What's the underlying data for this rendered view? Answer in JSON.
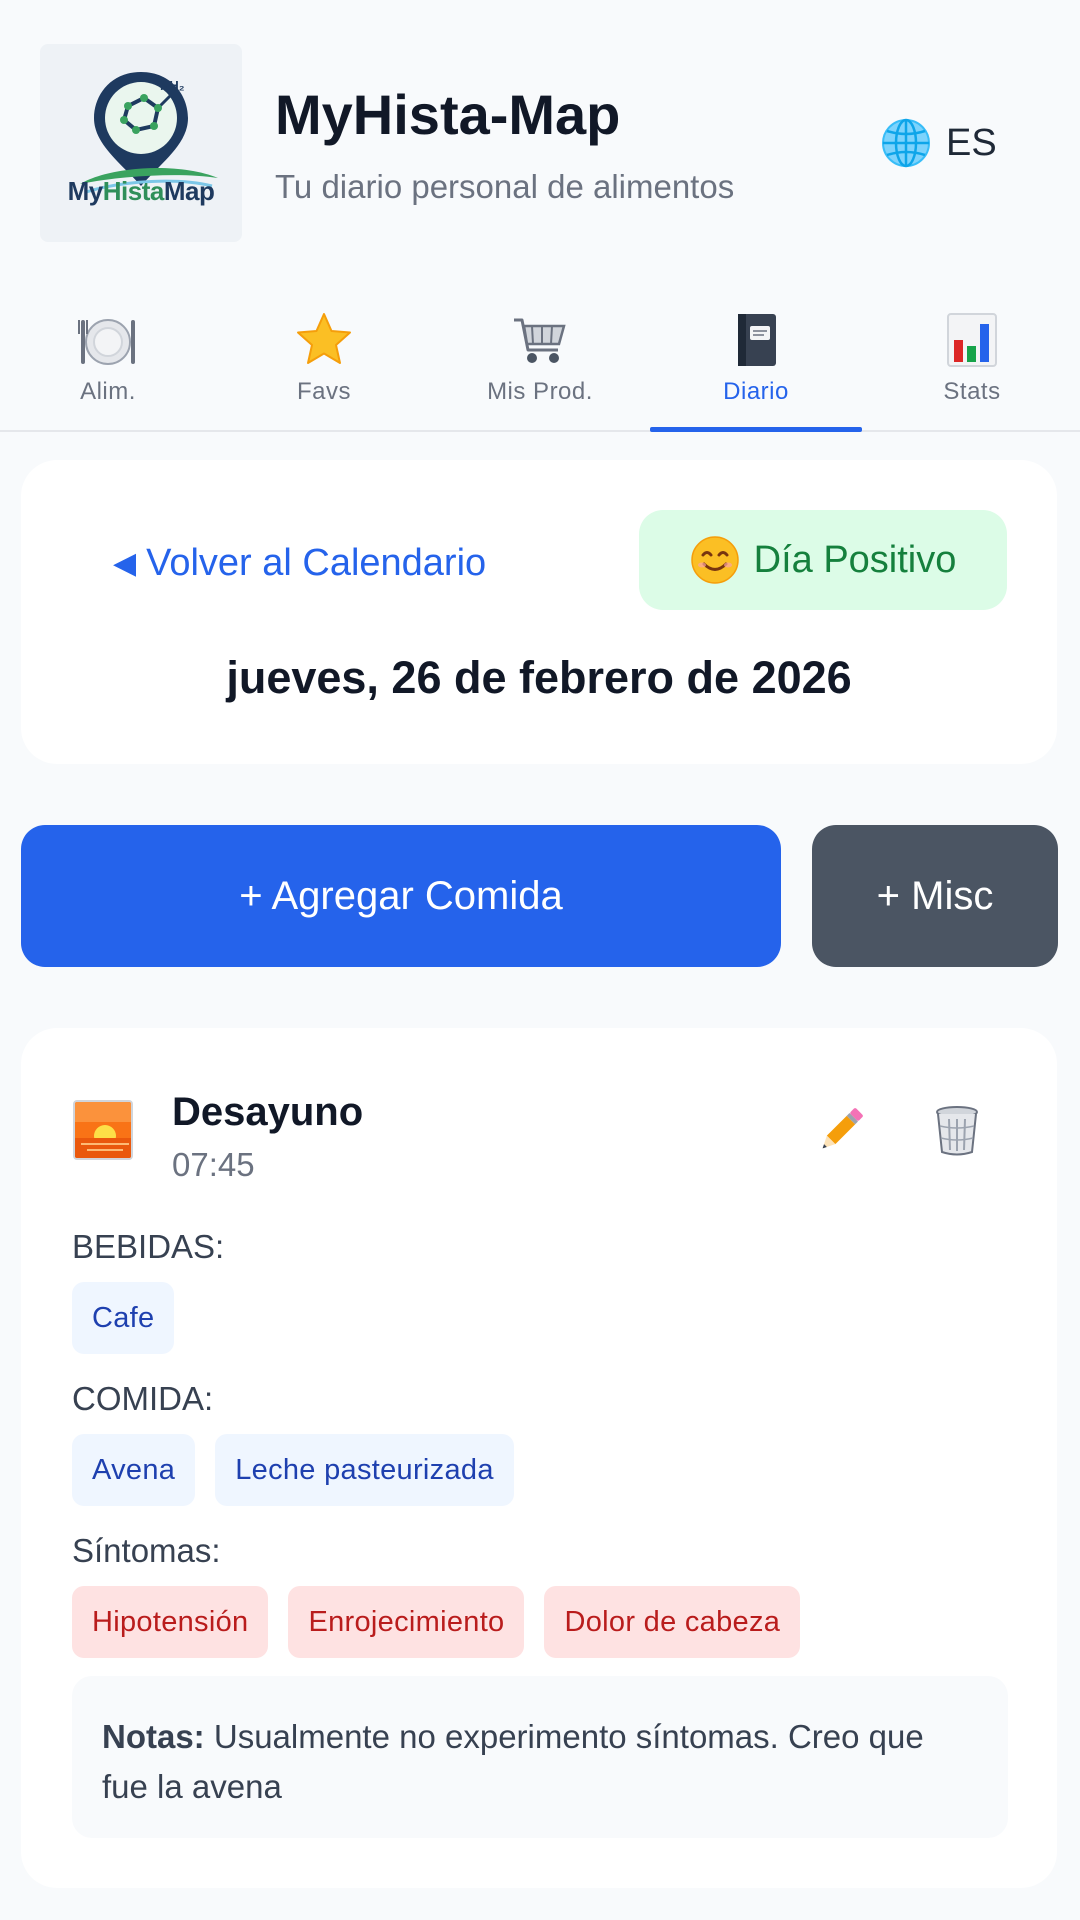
{
  "header": {
    "logo_text_my": "My",
    "logo_text_hista": "Hista",
    "logo_text_map": "Map",
    "logo_formula": "NH₂",
    "title": "MyHista-Map",
    "subtitle": "Tu diario personal de alimentos",
    "language": "ES",
    "language_icon": "globe-icon"
  },
  "tabs": [
    {
      "label": "Alim.",
      "icon": "plate-icon",
      "active": false
    },
    {
      "label": "Favs",
      "icon": "star-icon",
      "active": false
    },
    {
      "label": "Mis Prod.",
      "icon": "cart-icon",
      "active": false
    },
    {
      "label": "Diario",
      "icon": "notebook-icon",
      "active": true
    },
    {
      "label": "Stats",
      "icon": "bar-chart-icon",
      "active": false
    }
  ],
  "day": {
    "back_label": "Volver al Calendario",
    "mood_emoji": "😊",
    "mood_label": "Día Positivo",
    "date": "jueves, 26 de febrero de 2026"
  },
  "actions": {
    "add_meal": "+ Agregar Comida",
    "add_misc": "+ Misc"
  },
  "meal": {
    "name": "Desayuno",
    "time": "07:45",
    "drinks_label": "BEBIDAS:",
    "drinks": [
      "Cafe"
    ],
    "food_label": "COMIDA:",
    "food": [
      "Avena",
      "Leche pasteurizada"
    ],
    "symptoms_label": "Síntomas:",
    "symptoms": [
      "Hipotensión",
      "Enrojecimiento",
      "Dolor de cabeza"
    ],
    "notes_label": "Notas:",
    "notes_text": "Usualmente no experimento síntomas. Creo que fue la avena"
  },
  "colors": {
    "primary": "#2563eb",
    "secondary_button": "#4b5563",
    "positive_bg": "#dcfce7",
    "positive_text": "#15803d",
    "chip_food_bg": "#eff6ff",
    "chip_symptom_bg": "#fee2e2",
    "chip_symptom_text": "#b91c1c"
  }
}
